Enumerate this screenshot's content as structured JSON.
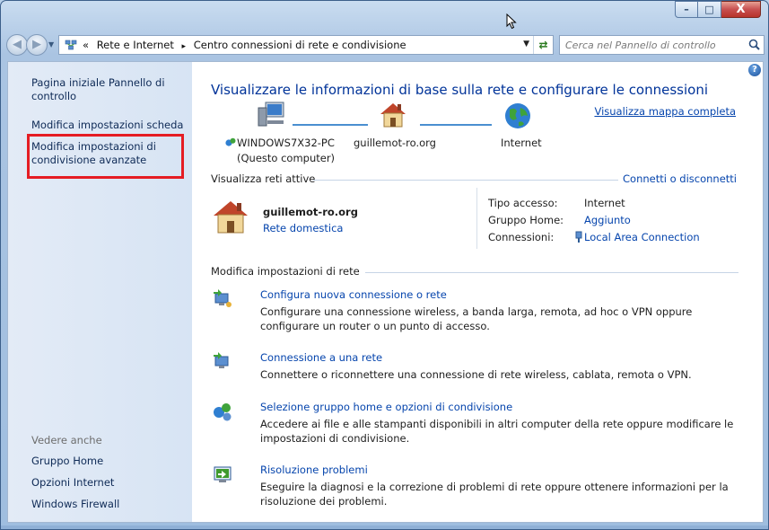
{
  "window": {
    "caption_min": "–",
    "caption_max": "□",
    "caption_close": "X"
  },
  "address_bar": {
    "prefix": "«",
    "crumbs": [
      "Rete e Internet",
      "Centro connessioni di rete e condivisione"
    ],
    "separator": "▸",
    "search_placeholder": "Cerca nel Pannello di controllo"
  },
  "sidebar": {
    "items": [
      {
        "label": "Pagina iniziale Pannello di controllo"
      },
      {
        "label": "Modifica impostazioni scheda"
      },
      {
        "label": "Modifica impostazioni di condivisione avanzate"
      }
    ],
    "see_also_title": "Vedere anche",
    "see_also": [
      {
        "label": "Gruppo Home"
      },
      {
        "label": "Opzioni Internet"
      },
      {
        "label": "Windows Firewall"
      }
    ]
  },
  "main": {
    "title": "Visualizzare le informazioni di base sulla rete e configurare le connessioni",
    "map_link": "Visualizza mappa completa",
    "map": {
      "computer_name": "WINDOWS7X32-PC",
      "computer_note": "(Questo computer)",
      "network_name": "guillemot-ro.org",
      "internet": "Internet"
    },
    "active_networks": {
      "title": "Visualizza reti attive",
      "connect_link": "Connetti o disconnetti",
      "network_name": "guillemot-ro.org",
      "network_type": "Rete domestica",
      "props": [
        {
          "label": "Tipo accesso:",
          "value": "Internet",
          "link": false
        },
        {
          "label": "Gruppo Home:",
          "value": "Aggiunto",
          "link": true
        },
        {
          "label": "Connessioni:",
          "value": "Local Area Connection",
          "link": true
        }
      ]
    },
    "settings": {
      "title": "Modifica impostazioni di rete",
      "tasks": [
        {
          "link": "Configura nuova connessione o rete",
          "desc": "Configurare una connessione wireless, a banda larga, remota, ad hoc o VPN oppure configurare un router o un punto di accesso."
        },
        {
          "link": "Connessione a una rete",
          "desc": "Connettere o riconnettere una connessione di rete wireless, cablata, remota o VPN."
        },
        {
          "link": "Selezione gruppo home e opzioni di condivisione",
          "desc": "Accedere ai file e alle stampanti disponibili in altri computer della rete oppure modificare le impostazioni di condivisione."
        },
        {
          "link": "Risoluzione problemi",
          "desc": "Eseguire la diagnosi e la correzione di problemi di rete oppure ottenere informazioni per la risoluzione dei problemi."
        }
      ]
    }
  },
  "colors": {
    "highlight": "#e51c23",
    "link": "#0645ad",
    "title": "#003399"
  }
}
